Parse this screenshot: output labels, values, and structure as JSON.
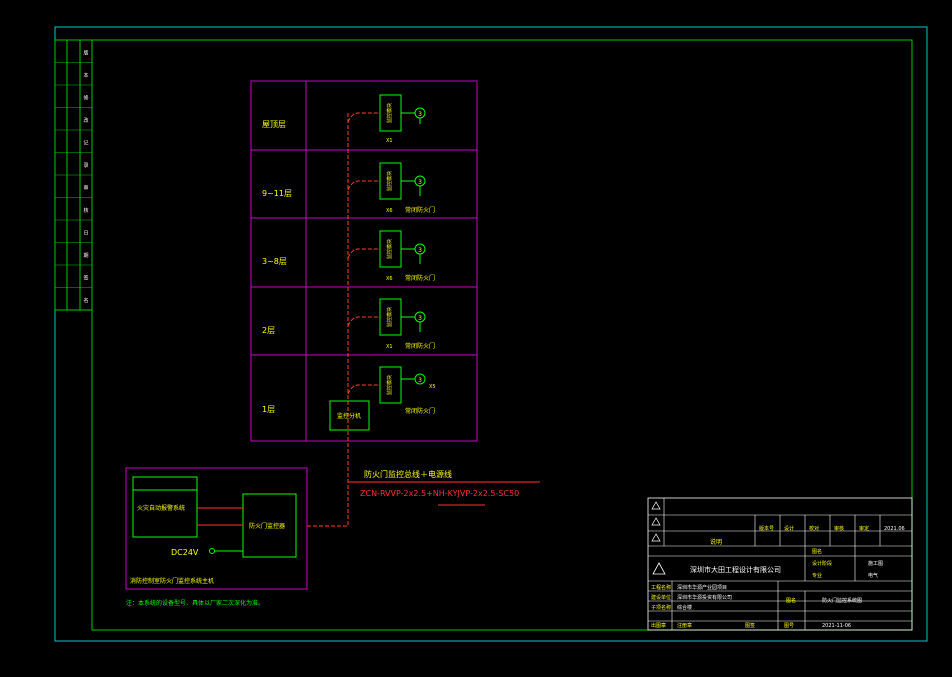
{
  "colors": {
    "background": "#000000",
    "frame_outer": "#00c8c8",
    "frame_inner": "#00c800",
    "purple": "#c800c8",
    "green": "#00ff00",
    "yellow": "#ffff00",
    "red_dash": "#ff4020",
    "red": "#ff3030",
    "white": "#ffffff"
  },
  "floors": [
    {
      "label": "屋顶层",
      "module": "监控模块",
      "device": "3",
      "qty": "X1",
      "unit": ""
    },
    {
      "label": "9~11层",
      "module": "监控模块",
      "device": "3",
      "qty": "X6",
      "unit": "常闭防火门"
    },
    {
      "label": "3~8层",
      "module": "监控模块",
      "device": "3",
      "qty": "X6",
      "unit": "常闭防火门"
    },
    {
      "label": "2层",
      "module": "监控模块",
      "device": "3",
      "qty": "X1",
      "unit": "常闭防火门"
    },
    {
      "label": "1层",
      "module": "监控模块",
      "device": "3",
      "qty": "X5",
      "unit": "常闭防火门"
    }
  ],
  "splitter_label": "监控分机",
  "cable_note": "防火门监控总线＋电源线",
  "cable_spec": "ZCN-RVVP-2x2.5+NH-KYJVP-2x2.5-SC50",
  "control_room": {
    "panel_label": "火灾自动报警系统",
    "host_label": "防火门监控器",
    "power_label": "DC24V",
    "room_label": "消防控制室防火门监控系统主机"
  },
  "footnote": "注：本系统的设备型号、具体以厂家二次深化为准。",
  "left_strip": [
    "版",
    "本",
    "修",
    "改",
    "记",
    "录",
    "审",
    "核",
    "日",
    "期",
    "签",
    "名"
  ],
  "title_block": {
    "company": "深圳市大田工程设计有限公司",
    "sign_headers": [
      "版本号",
      "设计",
      "校对",
      "审核",
      "审定",
      "日期"
    ],
    "sign_values": [
      "",
      "",
      "",
      "",
      "",
      "2021.06"
    ],
    "desc_label": "说明",
    "drawing_title_label": "图名",
    "drawing_title": "防火门监控系统图",
    "project_label": "工程名称",
    "project": "深圳市华源产业园项目",
    "client_label": "建设单位",
    "client": "深圳市华源投资有限公司",
    "subitem_label": "子项名称",
    "subitem": "综合楼",
    "phase_label": "设计阶段",
    "phase": "施工图",
    "discipline_label": "专业",
    "discipline": "电气",
    "scale_label": "比例",
    "scale": "",
    "number_label": "图号",
    "number": "",
    "sheet_label": "张数",
    "sheet": "",
    "date": "2021-11-06",
    "stamp_note": "图纸专用章",
    "row_cells": [
      "出图章",
      "注册章",
      "图签"
    ]
  }
}
